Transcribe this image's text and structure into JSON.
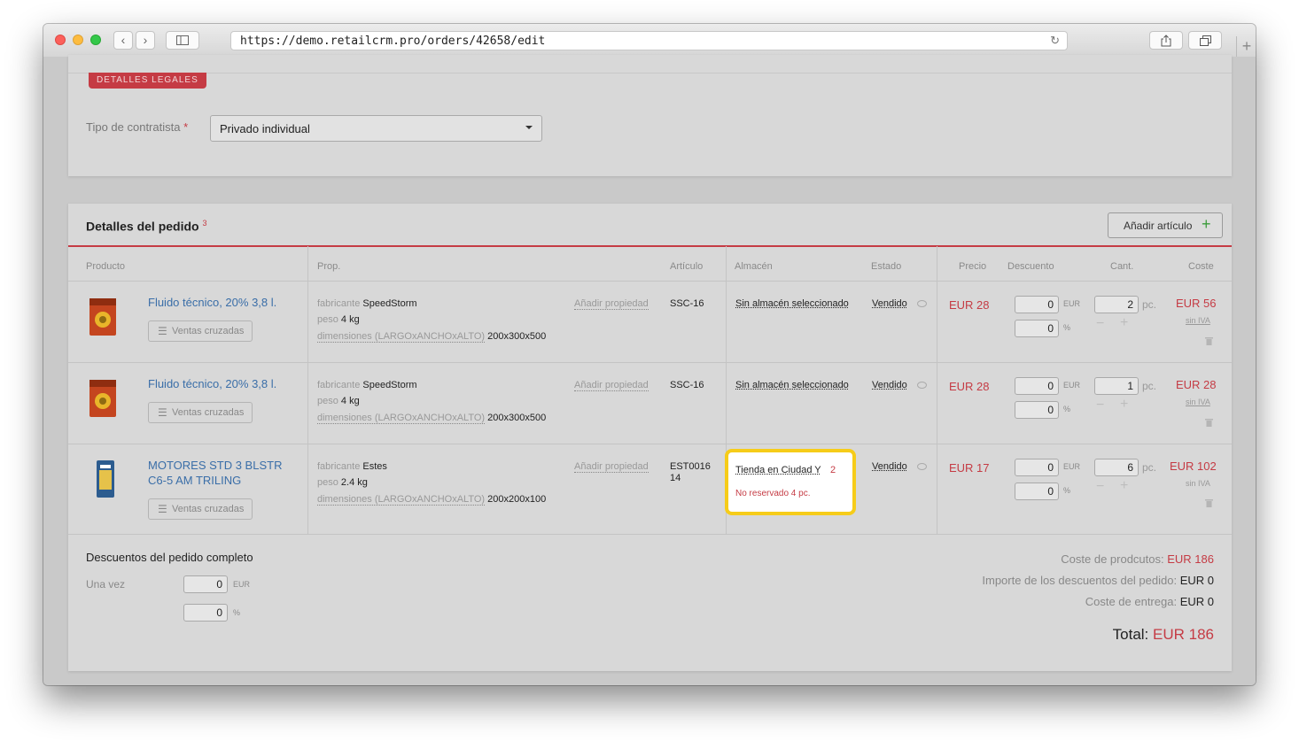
{
  "browser": {
    "url": "https://demo.retailcrm.pro/orders/42658/edit",
    "back": "‹",
    "forward": "›",
    "new_tab": "+"
  },
  "legal": {
    "badge": "DETALLES LEGALES",
    "contractor_label": "Tipo de contratista",
    "required_mark": "*",
    "contractor_value": "Privado individual"
  },
  "order": {
    "title": "Detalles del pedido",
    "count": "3",
    "add_button": "Añadir artículo",
    "add_icon": "+",
    "columns": {
      "product": "Producto",
      "prop": "Prop.",
      "article": "Artículo",
      "warehouse": "Almacén",
      "status": "Estado",
      "price": "Precio",
      "discount": "Descuento",
      "qty": "Cant.",
      "cost": "Coste"
    },
    "cross_sell": "Ventas cruzadas",
    "add_property": "Añadir propiedad",
    "unit_eur": "EUR",
    "unit_pct": "%",
    "unit_pc": "pc.",
    "sin_iva": "sin IVA",
    "prop_labels": {
      "maker": "fabricante",
      "weight": "peso",
      "dims": "dimensiones (LARGOxANCHOxALTO)"
    },
    "items": [
      {
        "name": "Fluido técnico, 20% 3,8 l.",
        "maker": "SpeedStorm",
        "weight": "4 kg",
        "dims": "200x300x500",
        "article": "SSC-16",
        "warehouse": "Sin almacén seleccionado",
        "status": "Vendido",
        "price": "EUR 28",
        "discount_eur": "0",
        "discount_pct": "0",
        "qty": "2",
        "cost": "EUR 56"
      },
      {
        "name": "Fluido técnico, 20% 3,8 l.",
        "maker": "SpeedStorm",
        "weight": "4 kg",
        "dims": "200x300x500",
        "article": "SSC-16",
        "warehouse": "Sin almacén seleccionado",
        "status": "Vendido",
        "price": "EUR 28",
        "discount_eur": "0",
        "discount_pct": "0",
        "qty": "1",
        "cost": "EUR 28"
      },
      {
        "name_line1": "MOTORES STD 3 BLSTR",
        "name_line2": "C6-5 AM TRILING",
        "maker": "Estes",
        "weight": "2.4 kg",
        "dims": "200x200x100",
        "article_line1": "EST0016",
        "article_line2": "14",
        "warehouse": "Tienda en Ciudad Y",
        "warehouse_count": "2",
        "warehouse_note": "No reservado 4 pc.",
        "status": "Vendido",
        "price": "EUR 17",
        "discount_eur": "0",
        "discount_pct": "0",
        "qty": "6",
        "cost": "EUR 102"
      }
    ]
  },
  "discounts": {
    "title": "Descuentos del pedido completo",
    "once_label": "Una vez",
    "eur_value": "0",
    "pct_value": "0"
  },
  "summary": {
    "products_label": "Coste de prodcutos:",
    "products_value": "EUR 186",
    "discount_label": "Importe de los descuentos del pedido:",
    "discount_value": "EUR 0",
    "delivery_label": "Coste de entrega:",
    "delivery_value": "EUR 0",
    "total_label": "Total:",
    "total_value": "EUR 186"
  },
  "colors": {
    "accent_red": "#c53b44",
    "link_blue": "#3a6ea8",
    "highlight_yellow": "#f6cc19"
  }
}
